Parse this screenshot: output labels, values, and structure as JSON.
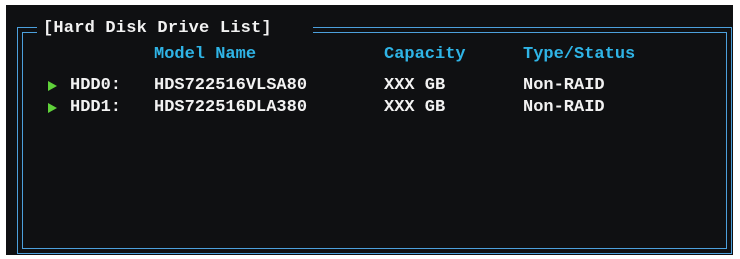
{
  "panel": {
    "title": "[Hard Disk Drive List]"
  },
  "columns": {
    "model": "Model Name",
    "capacity": "Capacity",
    "type_status": "Type/Status"
  },
  "drives": [
    {
      "id": "HDD0:",
      "model": "HDS722516VLSA80",
      "capacity": "XXX GB",
      "status": "Non-RAID"
    },
    {
      "id": "HDD1:",
      "model": "HDS722516DLA380",
      "capacity": "XXX GB",
      "status": "Non-RAID"
    }
  ],
  "colors": {
    "background": "#0f1012",
    "frame": "#4ca0dc",
    "header": "#2fb4e6",
    "text": "#f2f2f2",
    "arrow": "#5fd13a"
  },
  "icons": {
    "row_marker": "play-arrow-icon"
  }
}
